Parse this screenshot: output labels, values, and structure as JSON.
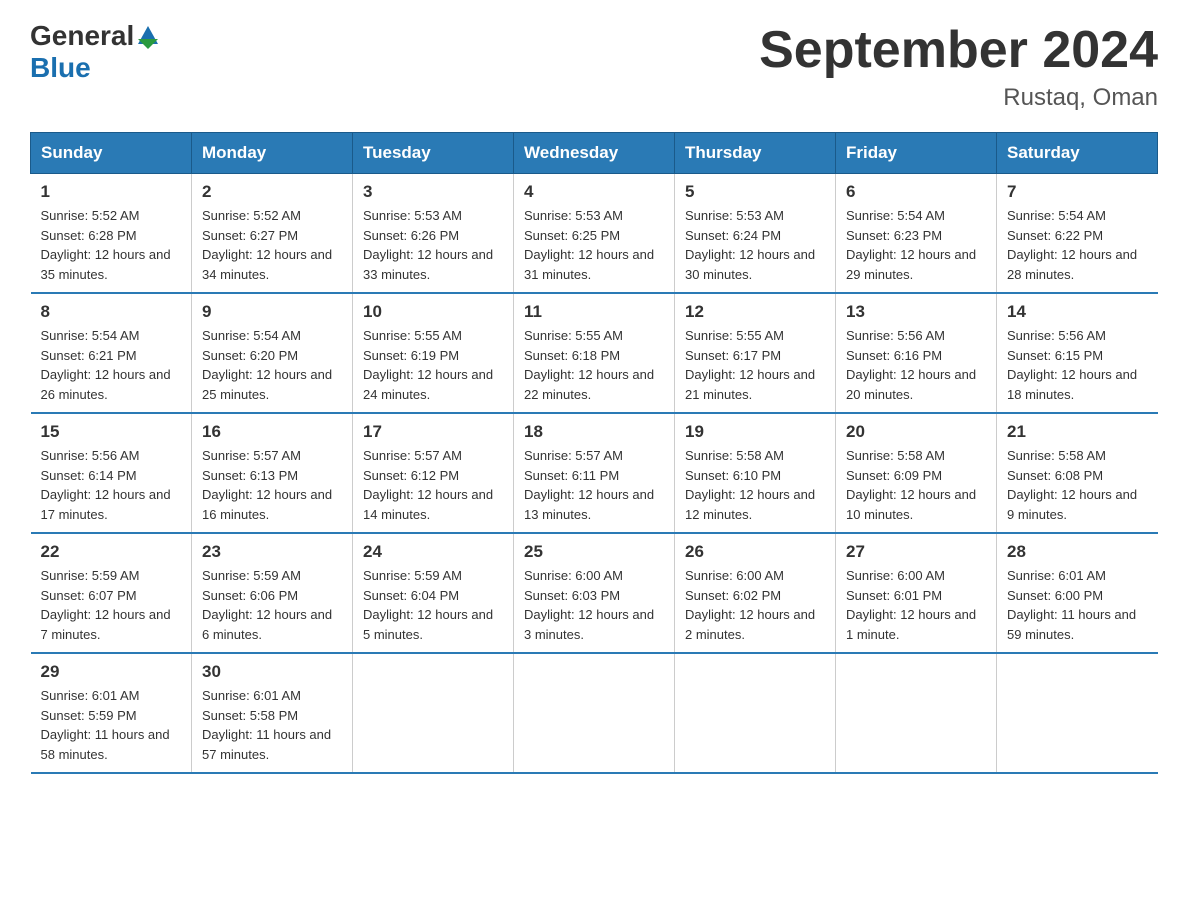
{
  "header": {
    "logo_general": "General",
    "logo_blue": "Blue",
    "title": "September 2024",
    "subtitle": "Rustaq, Oman"
  },
  "weekdays": [
    "Sunday",
    "Monday",
    "Tuesday",
    "Wednesday",
    "Thursday",
    "Friday",
    "Saturday"
  ],
  "weeks": [
    [
      {
        "day": "1",
        "sunrise": "5:52 AM",
        "sunset": "6:28 PM",
        "daylight": "12 hours and 35 minutes."
      },
      {
        "day": "2",
        "sunrise": "5:52 AM",
        "sunset": "6:27 PM",
        "daylight": "12 hours and 34 minutes."
      },
      {
        "day": "3",
        "sunrise": "5:53 AM",
        "sunset": "6:26 PM",
        "daylight": "12 hours and 33 minutes."
      },
      {
        "day": "4",
        "sunrise": "5:53 AM",
        "sunset": "6:25 PM",
        "daylight": "12 hours and 31 minutes."
      },
      {
        "day": "5",
        "sunrise": "5:53 AM",
        "sunset": "6:24 PM",
        "daylight": "12 hours and 30 minutes."
      },
      {
        "day": "6",
        "sunrise": "5:54 AM",
        "sunset": "6:23 PM",
        "daylight": "12 hours and 29 minutes."
      },
      {
        "day": "7",
        "sunrise": "5:54 AM",
        "sunset": "6:22 PM",
        "daylight": "12 hours and 28 minutes."
      }
    ],
    [
      {
        "day": "8",
        "sunrise": "5:54 AM",
        "sunset": "6:21 PM",
        "daylight": "12 hours and 26 minutes."
      },
      {
        "day": "9",
        "sunrise": "5:54 AM",
        "sunset": "6:20 PM",
        "daylight": "12 hours and 25 minutes."
      },
      {
        "day": "10",
        "sunrise": "5:55 AM",
        "sunset": "6:19 PM",
        "daylight": "12 hours and 24 minutes."
      },
      {
        "day": "11",
        "sunrise": "5:55 AM",
        "sunset": "6:18 PM",
        "daylight": "12 hours and 22 minutes."
      },
      {
        "day": "12",
        "sunrise": "5:55 AM",
        "sunset": "6:17 PM",
        "daylight": "12 hours and 21 minutes."
      },
      {
        "day": "13",
        "sunrise": "5:56 AM",
        "sunset": "6:16 PM",
        "daylight": "12 hours and 20 minutes."
      },
      {
        "day": "14",
        "sunrise": "5:56 AM",
        "sunset": "6:15 PM",
        "daylight": "12 hours and 18 minutes."
      }
    ],
    [
      {
        "day": "15",
        "sunrise": "5:56 AM",
        "sunset": "6:14 PM",
        "daylight": "12 hours and 17 minutes."
      },
      {
        "day": "16",
        "sunrise": "5:57 AM",
        "sunset": "6:13 PM",
        "daylight": "12 hours and 16 minutes."
      },
      {
        "day": "17",
        "sunrise": "5:57 AM",
        "sunset": "6:12 PM",
        "daylight": "12 hours and 14 minutes."
      },
      {
        "day": "18",
        "sunrise": "5:57 AM",
        "sunset": "6:11 PM",
        "daylight": "12 hours and 13 minutes."
      },
      {
        "day": "19",
        "sunrise": "5:58 AM",
        "sunset": "6:10 PM",
        "daylight": "12 hours and 12 minutes."
      },
      {
        "day": "20",
        "sunrise": "5:58 AM",
        "sunset": "6:09 PM",
        "daylight": "12 hours and 10 minutes."
      },
      {
        "day": "21",
        "sunrise": "5:58 AM",
        "sunset": "6:08 PM",
        "daylight": "12 hours and 9 minutes."
      }
    ],
    [
      {
        "day": "22",
        "sunrise": "5:59 AM",
        "sunset": "6:07 PM",
        "daylight": "12 hours and 7 minutes."
      },
      {
        "day": "23",
        "sunrise": "5:59 AM",
        "sunset": "6:06 PM",
        "daylight": "12 hours and 6 minutes."
      },
      {
        "day": "24",
        "sunrise": "5:59 AM",
        "sunset": "6:04 PM",
        "daylight": "12 hours and 5 minutes."
      },
      {
        "day": "25",
        "sunrise": "6:00 AM",
        "sunset": "6:03 PM",
        "daylight": "12 hours and 3 minutes."
      },
      {
        "day": "26",
        "sunrise": "6:00 AM",
        "sunset": "6:02 PM",
        "daylight": "12 hours and 2 minutes."
      },
      {
        "day": "27",
        "sunrise": "6:00 AM",
        "sunset": "6:01 PM",
        "daylight": "12 hours and 1 minute."
      },
      {
        "day": "28",
        "sunrise": "6:01 AM",
        "sunset": "6:00 PM",
        "daylight": "11 hours and 59 minutes."
      }
    ],
    [
      {
        "day": "29",
        "sunrise": "6:01 AM",
        "sunset": "5:59 PM",
        "daylight": "11 hours and 58 minutes."
      },
      {
        "day": "30",
        "sunrise": "6:01 AM",
        "sunset": "5:58 PM",
        "daylight": "11 hours and 57 minutes."
      },
      null,
      null,
      null,
      null,
      null
    ]
  ]
}
